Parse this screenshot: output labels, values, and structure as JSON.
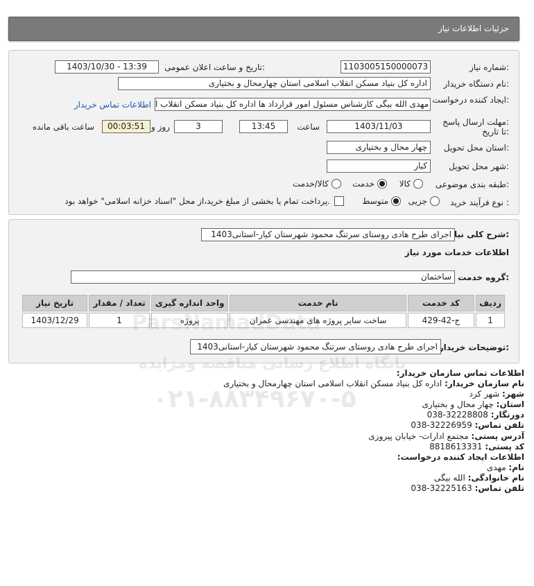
{
  "header": {
    "title": "جزئیات اطلاعات نیاز"
  },
  "form": {
    "need_number_label": "شماره نیاز:",
    "need_number": "1103005150000073",
    "announce_label": "تاریخ و ساعت اعلان عمومی:",
    "announce_value": "1403/10/30 - 13:39",
    "buyer_org_label": "نام دستگاه خریدار:",
    "buyer_org": "اداره کل بنیاد مسکن انقلاب اسلامی استان چهارمحال و بختیاری",
    "creator_label": "ایجاد کننده درخواست:",
    "creator_value": "مهدی الله بیگی کارشناس مسئول امور قرارداد ها اداره کل بنیاد مسکن انقلاب ا",
    "buyer_contact_link": "اطلاعات تماس خریدار",
    "deadline_label": "مهلت ارسال پاسخ:",
    "deadline_label2": "تا تاریخ:",
    "deadline_date": "1403/11/03",
    "time_label": "ساعت",
    "deadline_time": "13:45",
    "days_value": "3",
    "days_label": "روز و",
    "remaining_time": "00:03:51",
    "remaining_label": "ساعت باقی مانده",
    "province_label": "استان محل تحویل:",
    "province_value": "چهار محال و بختیاری",
    "city_label": "شهر محل تحویل:",
    "city_value": "کیار",
    "category_label": "طبقه بندی موضوعی:",
    "category_options": [
      "کالا",
      "خدمت",
      "کالا/خدمت"
    ],
    "category_selected": "خدمت",
    "process_label": "نوع فرآیند خرید :",
    "process_options": [
      "جزیی",
      "متوسط"
    ],
    "process_selected": "متوسط",
    "payment_note": "پرداخت تمام یا بخشی از مبلغ خرید،از محل \"اسناد خزانه اسلامی\" خواهد بود."
  },
  "description": {
    "summary_label": "شرح کلی نیاز:",
    "summary_value": "اجرای طرح هادی روستای سرتنگ محمود شهرستان کیار-استانی1403",
    "services_title": "اطلاعات خدمات مورد نیاز",
    "service_group_label": "گروه خدمت:",
    "service_group_value": "ساختمان",
    "table": {
      "headers": [
        "ردیف",
        "کد خدمت",
        "نام خدمت",
        "واحد اندازه گیری",
        "تعداد / مقدار",
        "تاریخ نیاز"
      ],
      "rows": [
        [
          "1",
          "ج-42-429",
          "ساخت سایر پروژه های مهندسی عمران",
          "پروژه",
          "1",
          "1403/12/29"
        ]
      ]
    },
    "buyer_notes_label": "توضیحات خریدار:",
    "buyer_notes_value": "اجرای طرح هادی روستای سرتنگ محمود شهرستان کیار-استانی1403"
  },
  "contact": {
    "org_title": "اطلاعات تماس سازمان خریدار:",
    "org_name_label": "نام سازمان خریدار:",
    "org_name_value": "اداره کل بنیاد مسکن انقلاب اسلامی استان چهارمحال و بختیاری",
    "city_label": "شهر:",
    "city_value": "شهر کرد",
    "province_label": "استان:",
    "province_value": "چهار محال و بختیاری",
    "fax_label": "دورنگار:",
    "fax_value": "038-32228808",
    "phone_label": "تلفن تماس:",
    "phone_value": "038-32226959",
    "address_label": "آدرس پستی:",
    "address_value": "مجتمع ادارات- خیابان پیروزی",
    "postal_label": "کد پستی:",
    "postal_value": "8818613331",
    "creator_title": "اطلاعات ایجاد کننده درخواست:",
    "name_label": "نام:",
    "name_value": "مهدی",
    "family_label": "نام خانوادگی:",
    "family_value": "الله بیگی",
    "creator_phone_label": "تلفن تماس:",
    "creator_phone_value": "038-32225163"
  },
  "watermark": {
    "brand": "ParsNamadData",
    "subtitle": "پایگاه اطلاع رسانی مناقصه ومزایده",
    "phone": "۰۲۱-۸۸۳۴۹۶۷۰-۵"
  }
}
